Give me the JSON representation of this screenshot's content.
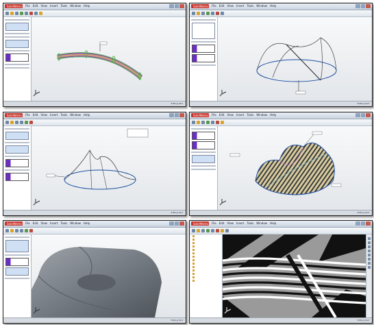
{
  "brand": {
    "logo_text": "SolidWorks",
    "logo_color": "#c8342b"
  },
  "menu_labels": [
    "File",
    "Edit",
    "View",
    "Insert",
    "Tools",
    "Window",
    "Help"
  ],
  "panels": [
    {
      "id": "panel-1",
      "title": "SolidWorks",
      "view": "curved-tube-ribbon",
      "status": "Editing Part"
    },
    {
      "id": "panel-2",
      "title": "SolidWorks",
      "view": "dome-wireframe-sketch",
      "status": "Editing Part"
    },
    {
      "id": "panel-3",
      "title": "SolidWorks",
      "view": "dome-wireframe-projection",
      "status": "Editing Part"
    },
    {
      "id": "panel-4",
      "title": "SolidWorks",
      "view": "lofted-surface-zebra",
      "status": "Editing Part"
    },
    {
      "id": "panel-5",
      "title": "SolidWorks",
      "view": "shaded-solid-closeup",
      "status": "Editing Part"
    },
    {
      "id": "panel-6",
      "title": "SolidWorks",
      "view": "zebra-stripes-closeup",
      "status": "Editing Part"
    }
  ],
  "colors": {
    "viewport_bg": "#eef0f3",
    "ribbon_purple": "#8a3fc7",
    "ribbon_green": "#52b548",
    "wire_blue": "#1c4fa3",
    "zebra_black": "#111111",
    "zebra_gray": "#9a9a9a",
    "solid_gray": "#7d828a",
    "sidebar_purple": "#6a2fc2"
  },
  "icons": [
    "axis-triad-icon",
    "solidworks-logo-icon",
    "toolbar-icon",
    "minimize-icon",
    "maximize-icon",
    "close-icon"
  ]
}
